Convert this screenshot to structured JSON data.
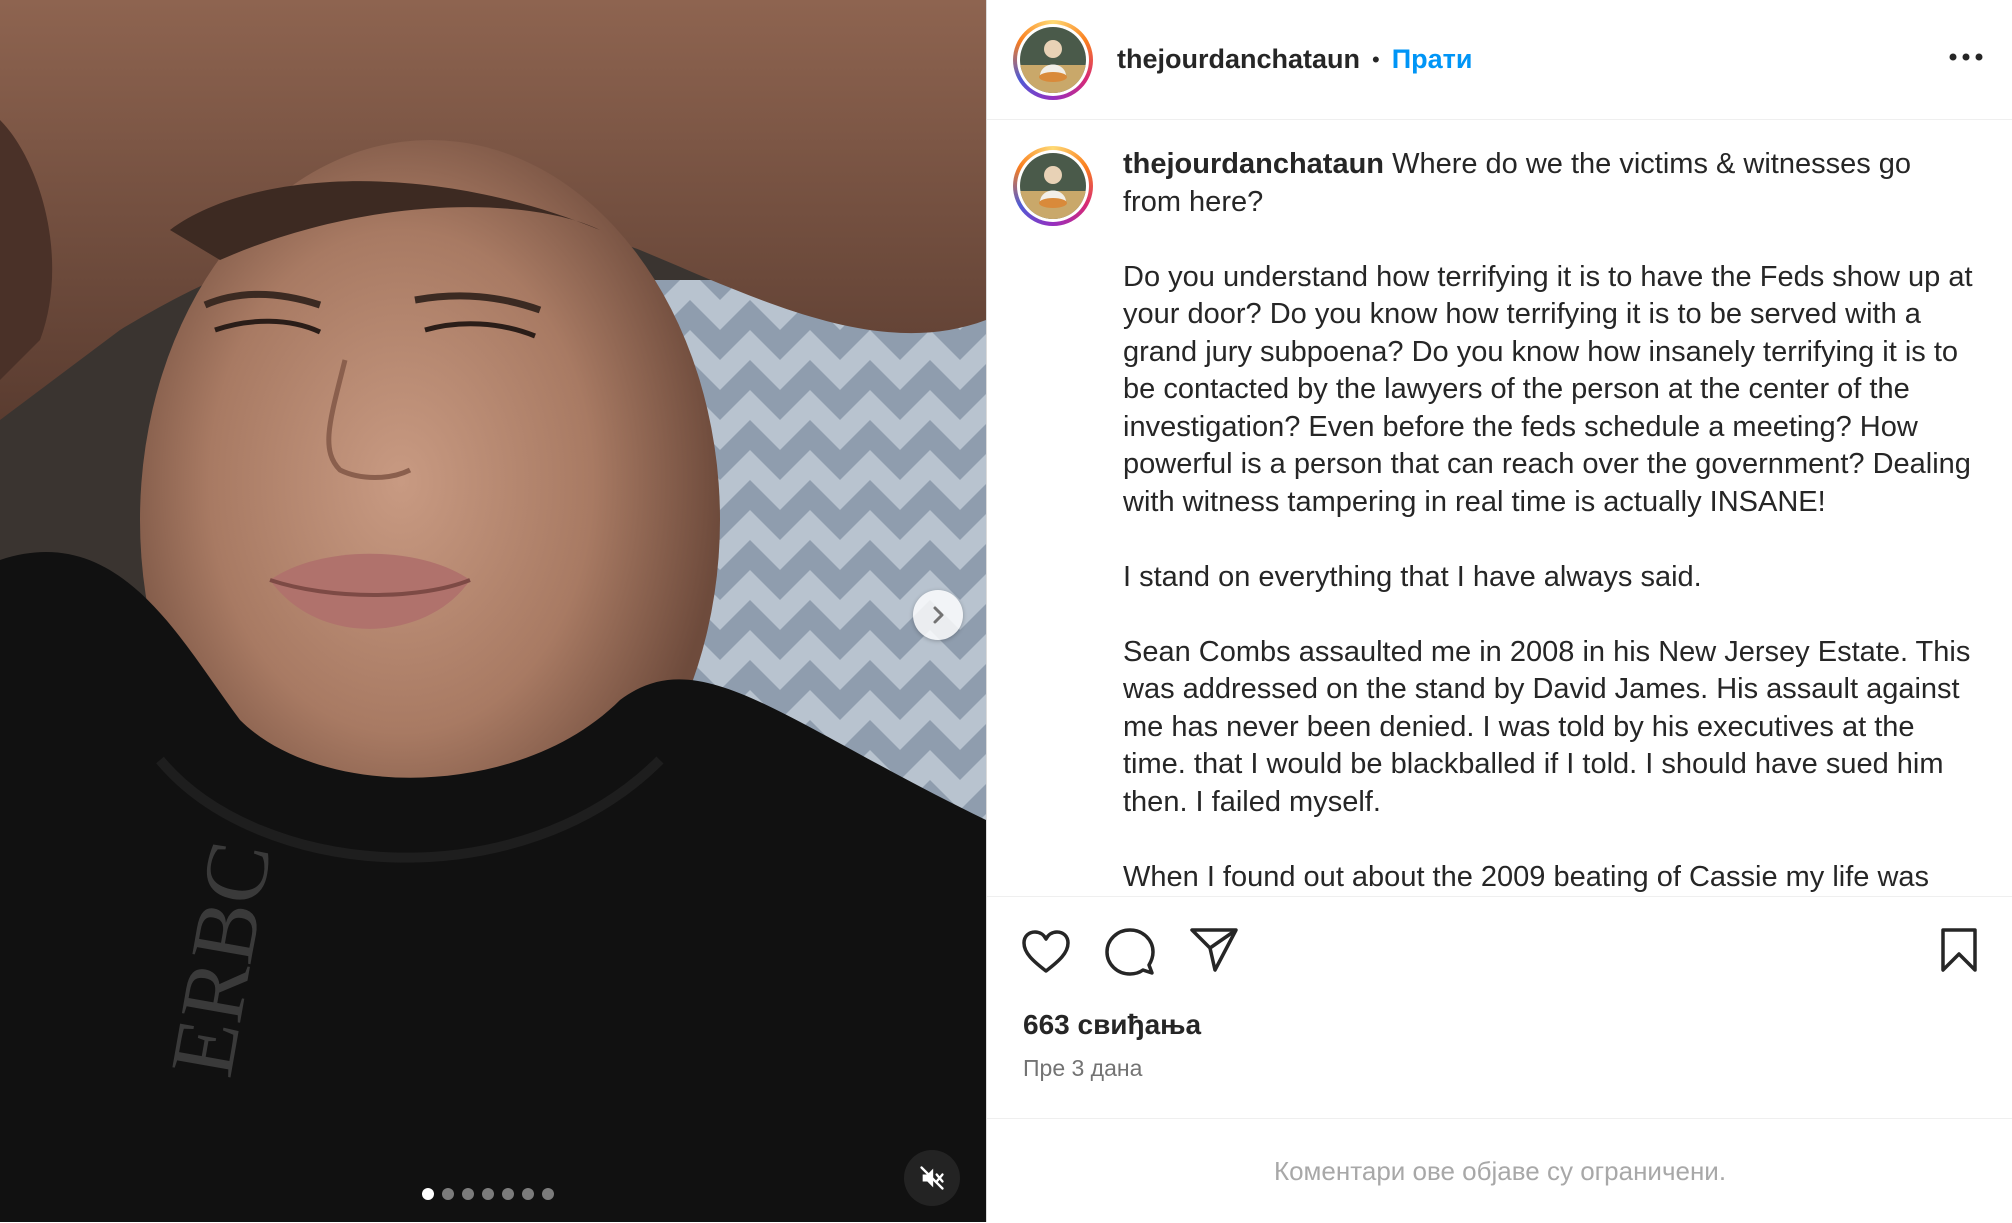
{
  "post": {
    "username": "thejourdanchataun",
    "separator": "•",
    "follow_label": "Прати",
    "more_icon": "more-horizontal-icon",
    "caption": {
      "username": "thejourdanchataun",
      "text": " Where do we the victims & witnesses go from here?\n\nDo you understand how terrifying it is to have the Feds show up at your door? Do you know how terrifying it is to be served with a grand jury subpoena? Do you know how insanely terrifying it is to be contacted by the lawyers of the person at the center of the investigation? Even before the feds schedule a meeting? How powerful is a person that can reach over the government? Dealing with witness tampering in real time is actually INSANE!\n\nI stand on everything that I have always said.\n\nSean Combs assaulted me in 2008 in his New Jersey Estate. This was addressed on the stand by David James. His assault against me has never been denied. I was told by his executives at the time. that I would be blackballed if I told. I should have sued him then. I failed myself.\n\nWhen I found out about the 2009 beating of Cassie my life was"
    },
    "likes": "663 свиђања",
    "time_ago": "Пре 3 дана",
    "comments_restricted": "Коментари ове објаве су ограничени.",
    "carousel": {
      "slide_count": 7,
      "current_index": 0
    },
    "icons": {
      "like": "heart-icon",
      "comment": "comment-icon",
      "share": "share-icon",
      "save": "bookmark-icon",
      "next": "chevron-right-icon",
      "mute": "muted-speaker-icon"
    }
  }
}
